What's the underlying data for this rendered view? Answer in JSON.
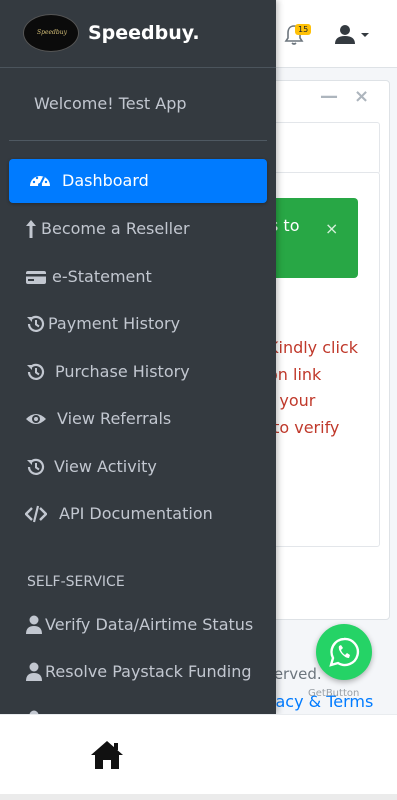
{
  "brand": {
    "name": "Speedbuy.",
    "logo_text": "Speedbuy"
  },
  "header": {
    "notification_count": "15"
  },
  "sidebar": {
    "welcome": "Welcome! Test App",
    "items": [
      {
        "label": "Dashboard",
        "icon": "tachometer-icon",
        "active": true
      },
      {
        "label": "Become a Reseller",
        "icon": "arrow-up-icon"
      },
      {
        "label": "e-Statement",
        "icon": "credit-card-icon"
      },
      {
        "label": "Payment History",
        "icon": "history-icon"
      },
      {
        "label": "Purchase History",
        "icon": "history-icon"
      },
      {
        "label": "View Referrals",
        "icon": "eye-icon"
      },
      {
        "label": "View Activity",
        "icon": "history-icon"
      },
      {
        "label": "API Documentation",
        "icon": "code-icon"
      }
    ],
    "section_header": "SELF-SERVICE",
    "self_service": [
      {
        "label": "Verify Data/Airtime Status",
        "icon": "user-icon"
      },
      {
        "label": "Resolve Paystack Funding",
        "icon": "user-icon"
      }
    ]
  },
  "background": {
    "alert_fragment": "s to",
    "alert_close": "×",
    "notice_fragment": "Kindly click\non link\nt your\n to verify",
    "footer_fragment": "served.",
    "footer_link_fragment": "vacy & Terms",
    "card_minimize": "—",
    "card_close": "×",
    "getbutton_label": "GetButton"
  },
  "colors": {
    "sidebar_bg": "#343a40",
    "active_bg": "#007bff",
    "alert_green": "#28a745",
    "notice_red": "#c0392b",
    "whatsapp_green": "#25d366",
    "badge_yellow": "#ffc107"
  }
}
